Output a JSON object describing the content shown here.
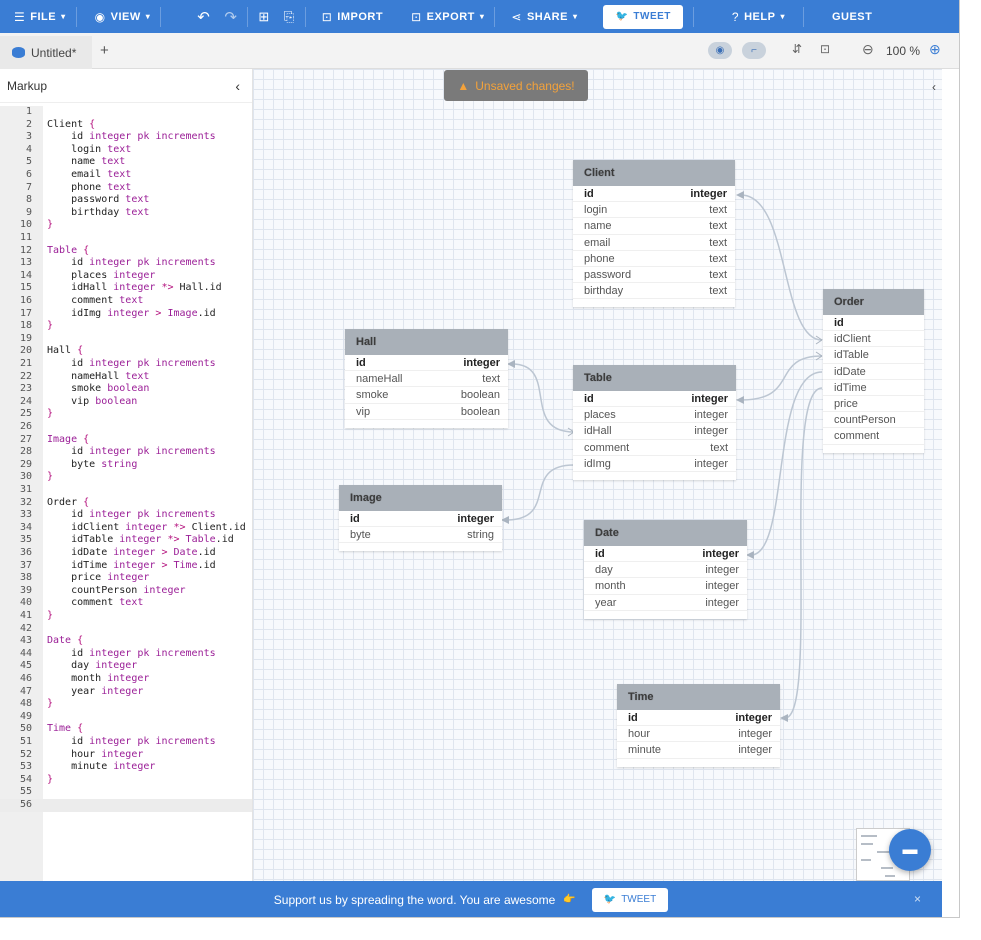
{
  "toolbar": {
    "file": "FILE",
    "view": "VIEW",
    "import": "IMPORT",
    "export": "EXPORT",
    "share": "SHARE",
    "tweet": "TWEET",
    "help": "HELP",
    "guest": "GUEST"
  },
  "tabs": {
    "current": "Untitled*",
    "add": "+"
  },
  "zoom": "100 %",
  "markup": {
    "title": "Markup"
  },
  "code_lines": [
    "",
    "Client {",
    "    id integer pk increments",
    "    login text",
    "    name text",
    "    email text",
    "    phone text",
    "    password text",
    "    birthday text",
    "}",
    "",
    "Table {",
    "    id integer pk increments",
    "    places integer",
    "    idHall integer *> Hall.id",
    "    comment text",
    "    idImg integer > Image.id",
    "}",
    "",
    "Hall {",
    "    id integer pk increments",
    "    nameHall text",
    "    smoke boolean",
    "    vip boolean",
    "}",
    "",
    "Image {",
    "    id integer pk increments",
    "    byte string",
    "}",
    "",
    "Order {",
    "    id integer pk increments",
    "    idClient integer *> Client.id",
    "    idTable integer *> Table.id",
    "    idDate integer > Date.id",
    "    idTime integer > Time.id",
    "    price integer",
    "    countPerson integer",
    "    comment text",
    "}",
    "",
    "Date {",
    "    id integer pk increments",
    "    day integer",
    "    month integer",
    "    year integer",
    "}",
    "",
    "Time {",
    "    id integer pk increments",
    "    hour integer",
    "    minute integer",
    "}",
    "",
    ""
  ],
  "unsaved": "Unsaved changes!",
  "tables": [
    {
      "name": "Client",
      "fields": [
        [
          "id",
          "integer"
        ],
        [
          "login",
          "text"
        ],
        [
          "name",
          "text"
        ],
        [
          "email",
          "text"
        ],
        [
          "phone",
          "text"
        ],
        [
          "password",
          "text"
        ],
        [
          "birthday",
          "text"
        ]
      ]
    },
    {
      "name": "Order",
      "fields": [
        [
          "id",
          ""
        ],
        [
          "idClient",
          ""
        ],
        [
          "idTable",
          ""
        ],
        [
          "idDate",
          ""
        ],
        [
          "idTime",
          ""
        ],
        [
          "price",
          ""
        ],
        [
          "countPerson",
          ""
        ],
        [
          "comment",
          ""
        ]
      ]
    },
    {
      "name": "Hall",
      "fields": [
        [
          "id",
          "integer"
        ],
        [
          "nameHall",
          "text"
        ],
        [
          "smoke",
          "boolean"
        ],
        [
          "vip",
          "boolean"
        ]
      ]
    },
    {
      "name": "Table",
      "fields": [
        [
          "id",
          "integer"
        ],
        [
          "places",
          "integer"
        ],
        [
          "idHall",
          "integer"
        ],
        [
          "comment",
          "text"
        ],
        [
          "idImg",
          "integer"
        ]
      ]
    },
    {
      "name": "Image",
      "fields": [
        [
          "id",
          "integer"
        ],
        [
          "byte",
          "string"
        ]
      ]
    },
    {
      "name": "Date",
      "fields": [
        [
          "id",
          "integer"
        ],
        [
          "day",
          "integer"
        ],
        [
          "month",
          "integer"
        ],
        [
          "year",
          "integer"
        ]
      ]
    },
    {
      "name": "Time",
      "fields": [
        [
          "id",
          "integer"
        ],
        [
          "hour",
          "integer"
        ],
        [
          "minute",
          "integer"
        ]
      ]
    }
  ],
  "banner": {
    "text": "Support us by spreading the word. You are awesome",
    "emoji": "👉",
    "tweet": "TWEET",
    "close": "×"
  },
  "colors": {
    "accent": "#3a7dd4",
    "table_header": "#a9b0b8",
    "keyword": "#9b1f97",
    "warning": "#f3a23b"
  }
}
